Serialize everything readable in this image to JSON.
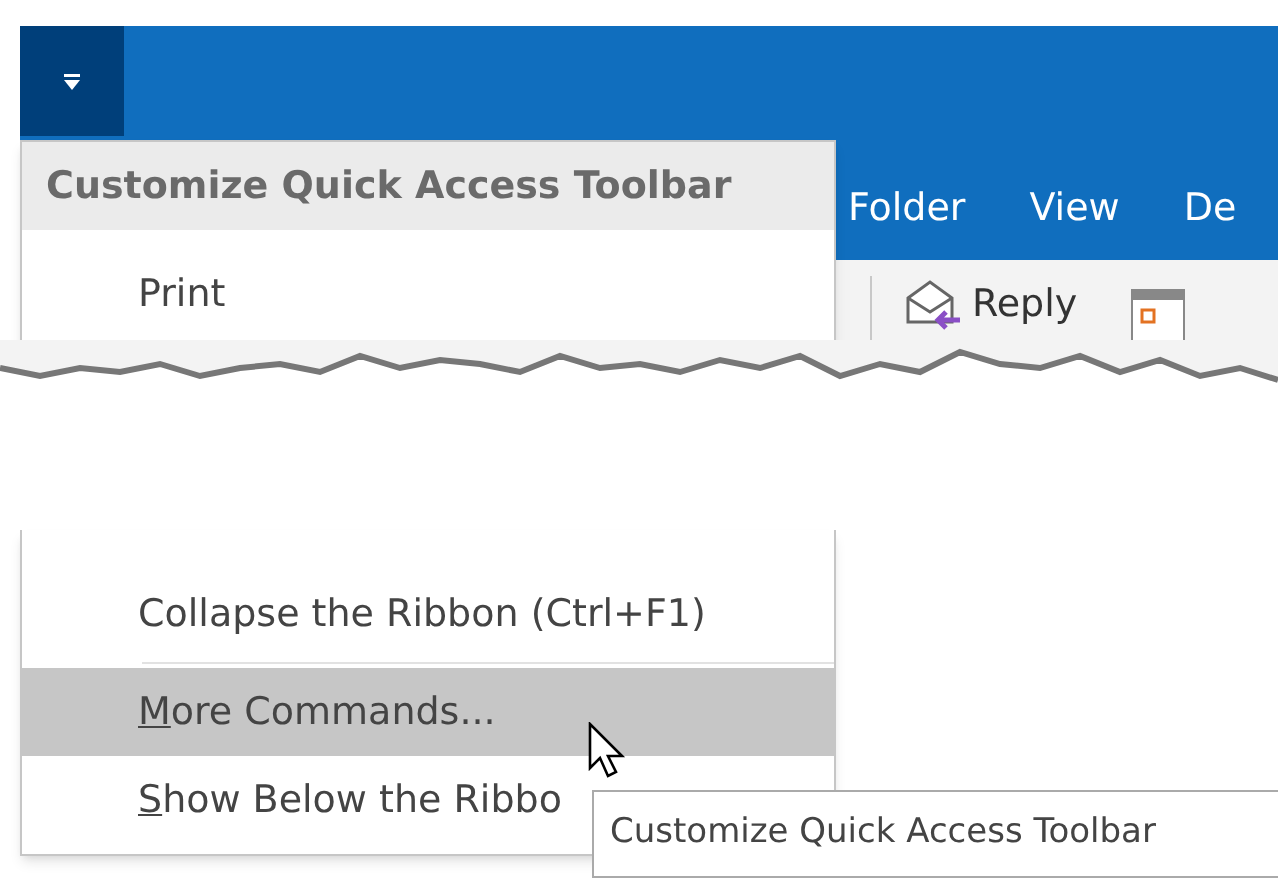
{
  "ribbon_tabs": [
    {
      "label": "Folder"
    },
    {
      "label": "View"
    },
    {
      "label": "De"
    }
  ],
  "ribbon": {
    "buttons": [
      {
        "label": "Reply"
      }
    ]
  },
  "menu": {
    "title": "Customize Quick Access Toolbar",
    "items_top": [
      {
        "kind": "command",
        "label": "Print",
        "selected": false,
        "underline_first": false
      }
    ],
    "items_bottom": [
      {
        "kind": "command",
        "label": "Collapse the Ribbon (Ctrl+F1)",
        "selected": false,
        "underline_first": false
      },
      {
        "kind": "separator"
      },
      {
        "kind": "command",
        "label": "More Commands...",
        "selected": true,
        "underline_first": true
      },
      {
        "kind": "command",
        "label": "Show Below the Ribbo",
        "selected": false,
        "underline_first": true
      }
    ]
  },
  "tooltip": {
    "text": "Customize Quick Access Toolbar"
  }
}
